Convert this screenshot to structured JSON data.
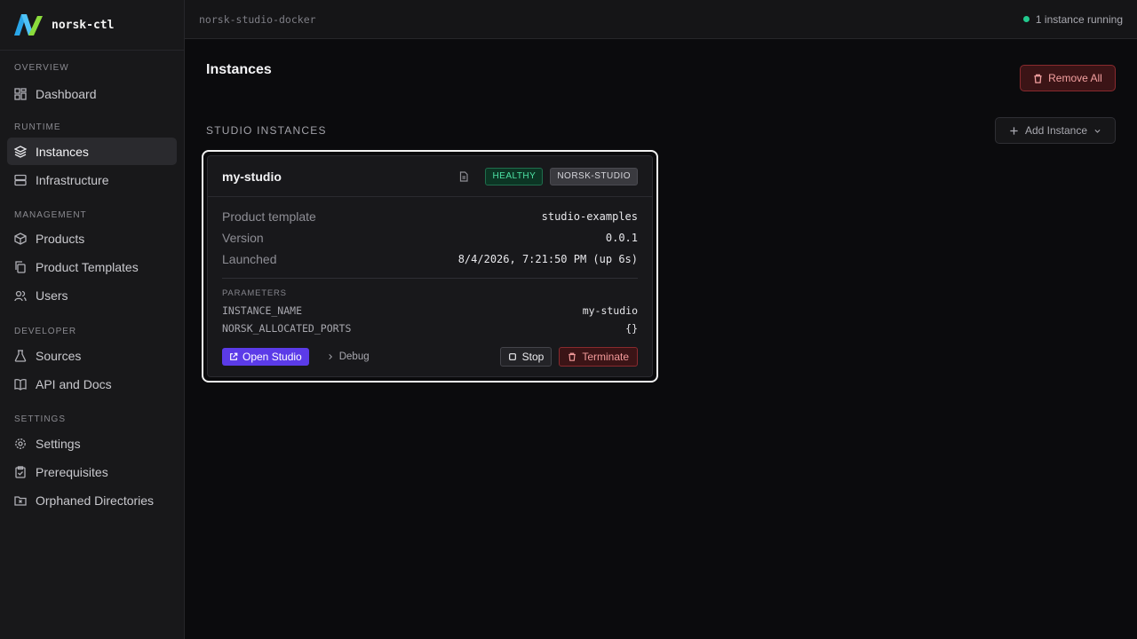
{
  "app": {
    "name": "norsk-ctl",
    "environment": "norsk-studio-docker"
  },
  "status": {
    "text": "1 instance running",
    "color": "#22c98e"
  },
  "sidebar": {
    "sections": [
      {
        "label": "OVERVIEW",
        "items": [
          {
            "label": "Dashboard",
            "icon": "dashboard-icon"
          }
        ]
      },
      {
        "label": "RUNTIME",
        "items": [
          {
            "label": "Instances",
            "icon": "layers-icon",
            "active": true
          },
          {
            "label": "Infrastructure",
            "icon": "server-icon"
          }
        ]
      },
      {
        "label": "MANAGEMENT",
        "items": [
          {
            "label": "Products",
            "icon": "package-icon"
          },
          {
            "label": "Product Templates",
            "icon": "copy-icon"
          },
          {
            "label": "Users",
            "icon": "users-icon"
          }
        ]
      },
      {
        "label": "DEVELOPER",
        "items": [
          {
            "label": "Sources",
            "icon": "flask-icon"
          },
          {
            "label": "API and Docs",
            "icon": "book-icon"
          }
        ]
      },
      {
        "label": "SETTINGS",
        "items": [
          {
            "label": "Settings",
            "icon": "gear-icon"
          },
          {
            "label": "Prerequisites",
            "icon": "clipboard-check-icon"
          },
          {
            "label": "Orphaned Directories",
            "icon": "folder-x-icon"
          }
        ]
      }
    ]
  },
  "main": {
    "title": "Instances",
    "remove_all_label": "Remove All",
    "section_title": "STUDIO INSTANCES",
    "add_instance_label": "Add Instance"
  },
  "instance": {
    "name": "my-studio",
    "health": "HEALTHY",
    "type": "NORSK-STUDIO",
    "details": [
      {
        "key": "Product template",
        "value": "studio-examples"
      },
      {
        "key": "Version",
        "value": "0.0.1"
      },
      {
        "key": "Launched",
        "value": "8/4/2026, 7:21:50 PM (up 6s)"
      }
    ],
    "parameters_label": "PARAMETERS",
    "parameters": [
      {
        "key": "INSTANCE_NAME",
        "value": "my-studio"
      },
      {
        "key": "NORSK_ALLOCATED_PORTS",
        "value": "{}"
      }
    ],
    "actions": {
      "open": "Open Studio",
      "debug": "Debug",
      "stop": "Stop",
      "terminate": "Terminate"
    }
  },
  "colors": {
    "accent": "#5b3be8",
    "danger": "#8a2a2e",
    "healthy": "#4ee2a4"
  }
}
